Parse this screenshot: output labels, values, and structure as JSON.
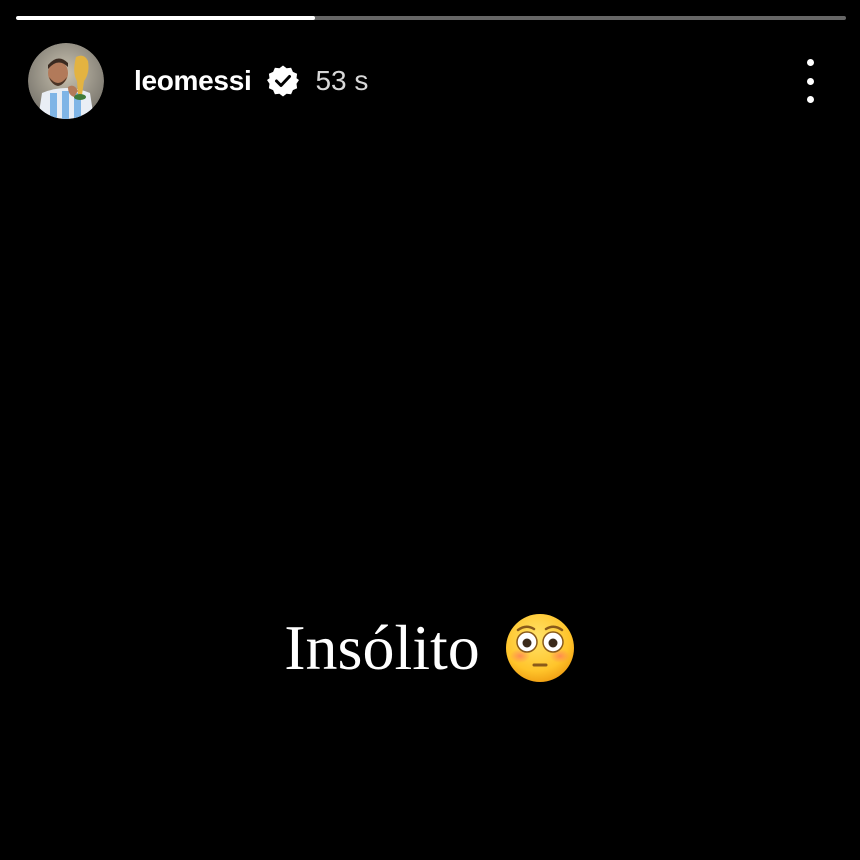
{
  "story": {
    "progress": 0.36,
    "username": "leomessi",
    "time_ago": "53 s",
    "verified": true,
    "caption": "Insólito",
    "emoji": "flushed-face-emoji"
  },
  "colors": {
    "background": "#000000",
    "text": "#ffffff",
    "verified_badge": "#ffffff"
  },
  "icons": {
    "verified": "verified-badge-icon",
    "more": "more-options-icon",
    "emoji": "flushed-face-emoji"
  }
}
